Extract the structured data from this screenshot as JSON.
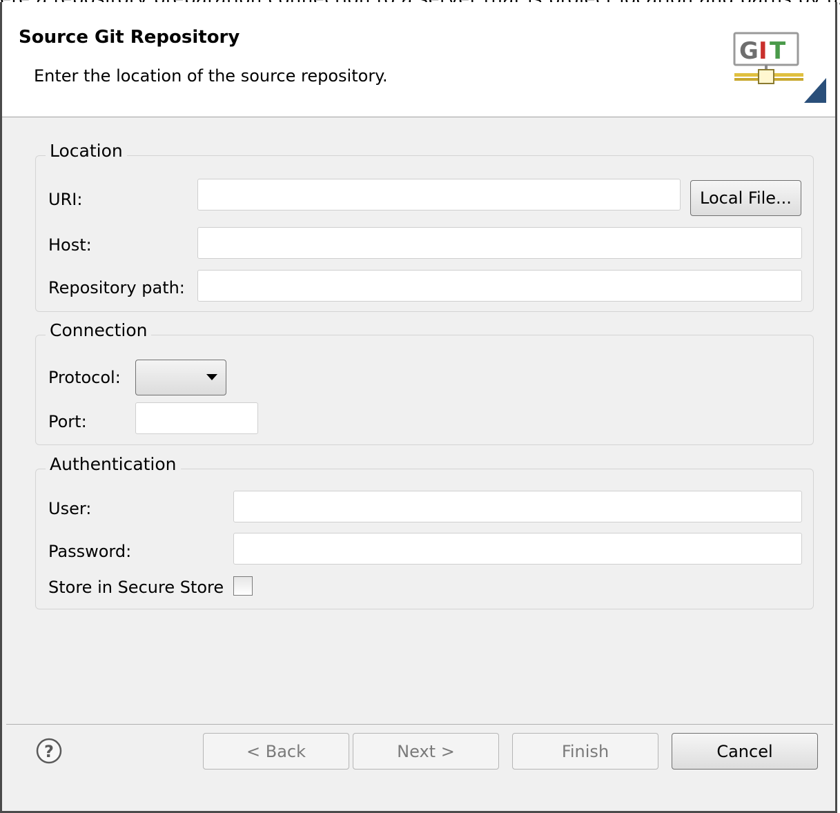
{
  "top_fragment": "ere a repository preparation connection to a server that is project location and paths by using",
  "banner": {
    "title": "Source Git Repository",
    "description": "Enter the location of the source repository.",
    "logo_text": "GIT",
    "logo_colors": {
      "G": "#6e6e6e",
      "I": "#c9302c",
      "T": "#4a9a4a"
    }
  },
  "location": {
    "legend": "Location",
    "uri_label": "URI:",
    "uri_value": "",
    "local_file_button": "Local File...",
    "host_label": "Host:",
    "host_value": "",
    "repo_path_label": "Repository path:",
    "repo_path_value": ""
  },
  "connection": {
    "legend": "Connection",
    "protocol_label": "Protocol:",
    "protocol_value": "",
    "port_label": "Port:",
    "port_value": ""
  },
  "authentication": {
    "legend": "Authentication",
    "user_label": "User:",
    "user_value": "",
    "password_label": "Password:",
    "password_value": "",
    "secure_store_label": "Store in Secure Store",
    "secure_store_checked": false
  },
  "footer": {
    "back": "< Back",
    "next": "Next >",
    "finish": "Finish",
    "cancel": "Cancel",
    "help_icon": "question-mark-circle"
  }
}
